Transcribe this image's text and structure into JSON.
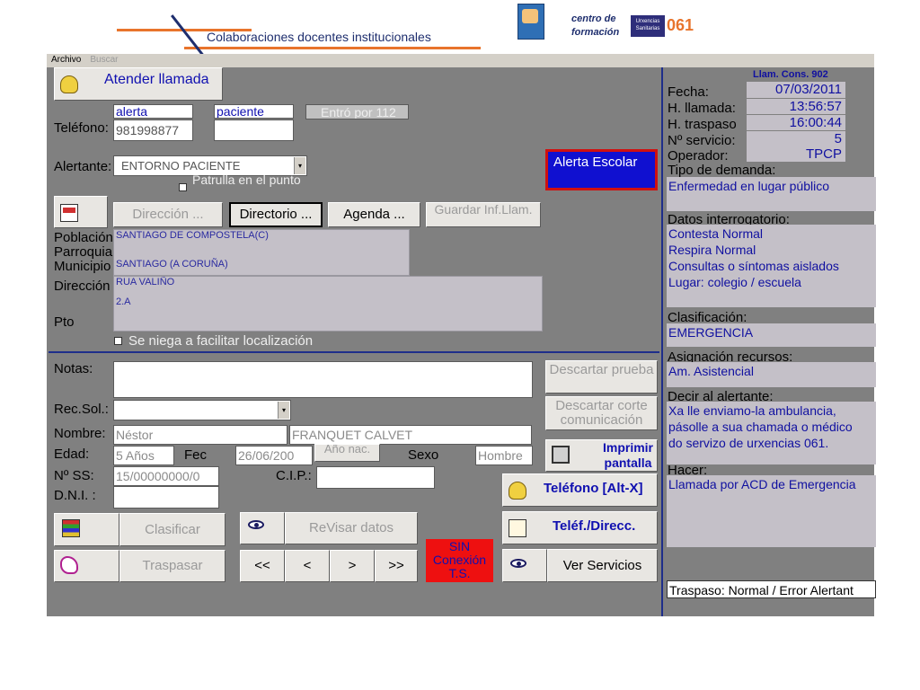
{
  "slide": {
    "title": "Colaboraciones docentes institucionales",
    "logo_cf_line1": "centro de",
    "logo_cf_line2": "formación",
    "logo_ux_text": "Urxencias Sanitarias",
    "logo_061": "061"
  },
  "menu": {
    "archivo": "Archivo",
    "buscar": "Buscar"
  },
  "left": {
    "atender_llamada": "Atender llamada",
    "tabs": {
      "alerta": "alerta",
      "paciente": "paciente"
    },
    "entro_por_112": "Entró por 112",
    "telefono_label": "Teléfono:",
    "telefono_value": "981998877",
    "alertante_label": "Alertante:",
    "alertante_value": "ENTORNO PACIENTE",
    "patrulla_label": "Patrulla en el punto",
    "alerta_escolar": "Alerta Escolar",
    "buttons": {
      "direccion": "Dirección ...",
      "directorio": "Directorio ...",
      "agenda": "Agenda ...",
      "guardar": "Guardar Inf.Llam."
    },
    "poblacion_label": "Población",
    "parroquia_label": "Parroquia",
    "municipio_label": "Municipio",
    "poblacion_value": "SANTIAGO DE COMPOSTELA(C)",
    "municipio_value": "SANTIAGO (A CORUÑA)",
    "direccion_label": "Dirección",
    "direccion_value": "RUA VALIÑO",
    "pto_label": "Pto",
    "pto_value": "2.A",
    "niega_label": "Se niega a facilitar localización",
    "notas_label": "Notas:",
    "descartar_prueba": "Descartar prueba",
    "descartar_corte": "Descartar corte comunicación",
    "recsol_label": "Rec.Sol.:",
    "nombre_label": "Nombre:",
    "nombre_value": "Néstor",
    "apellidos_value": "FRANQUET CALVET",
    "edad_label": "Edad:",
    "edad_value": "5 Años",
    "fec_label": "Fec",
    "fec_value": "26/06/200",
    "ano_nac": "Año nac.",
    "sexo_label": "Sexo",
    "sexo_value": "Hombre",
    "imprimir_pantalla": "Imprimir pantalla",
    "nss_label": "Nº SS:",
    "nss_value": "15/00000000/0",
    "cip_label": "C.I.P.:",
    "dni_label": "D.N.I. :",
    "telefono_altx": "Teléfono [Alt-X]",
    "clasificar": "Clasificar",
    "revisar_datos": "ReVisar datos",
    "telef_direcc": "Teléf./Direcc.",
    "traspasar": "Traspasar",
    "nav": {
      "first": "<<",
      "prev": "<",
      "next": ">",
      "last": ">>"
    },
    "sin_conexion": "SIN Conexión T.S.",
    "ver_servicios": "Ver Servicios"
  },
  "right": {
    "llam_cons": "Llam. Cons. 902",
    "fecha_label": "Fecha:",
    "fecha_value": "07/03/2011",
    "hllamada_label": "H. llamada:",
    "hllamada_value": "13:56:57",
    "htraspaso_label": "H. traspaso",
    "htraspaso_value": "16:00:44",
    "nservicio_label": "Nº servicio:",
    "nservicio_value": "5",
    "operador_label": "Operador:",
    "operador_value": "TPCP",
    "tipo_demanda_label": "Tipo de demanda:",
    "tipo_demanda_value": "Enfermedad en lugar público",
    "datos_interrogatorio_label": "Datos interrogatorio:",
    "datos_interrogatorio_lines": [
      "Contesta Normal",
      "Respira Normal",
      "Consultas o síntomas aislados",
      "Lugar: colegio / escuela"
    ],
    "clasificacion_label": "Clasificación:",
    "clasificacion_value": "EMERGENCIA",
    "asignacion_label": "Asignación recursos:",
    "asignacion_value": "Am. Asistencial",
    "decir_label": "Decir al alertante:",
    "decir_lines": [
      "Xa lle enviamo-la ambulancia,",
      "pásolle a sua chamada o médico",
      "do servizo de urxencias 061."
    ],
    "hacer_label": "Hacer:",
    "hacer_value": "Llamada por ACD de Emergencia",
    "traspaso_value": "Traspaso: Normal / Error Alertant"
  }
}
